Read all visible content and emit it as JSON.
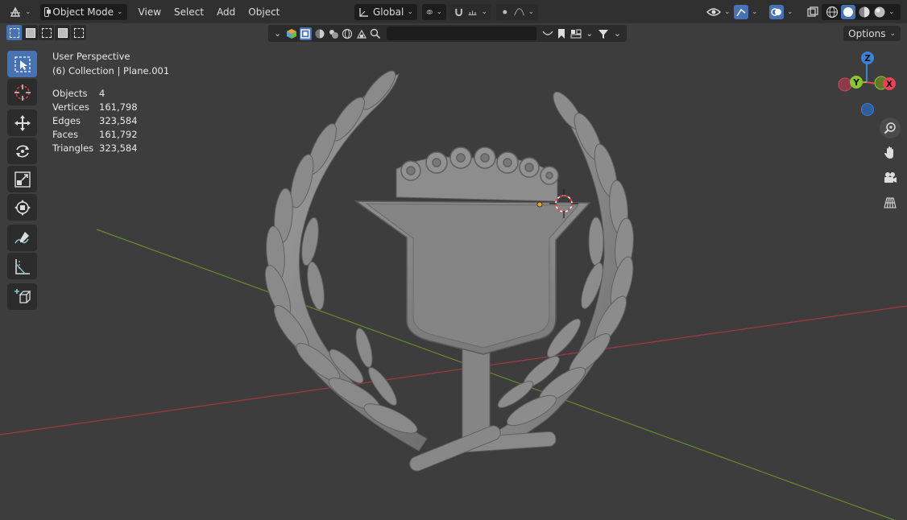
{
  "header": {
    "editor_type_icon": "3d-viewport-icon",
    "mode_label": "Object Mode",
    "menus": [
      "View",
      "Select",
      "Add",
      "Object"
    ],
    "transform_orientation": "Global"
  },
  "subbar": {
    "options_label": "Options",
    "search_placeholder": ""
  },
  "overlay": {
    "view_name": "User Perspective",
    "collection_info": "(6) Collection | Plane.001",
    "stats": [
      {
        "label": "Objects",
        "value": "4"
      },
      {
        "label": "Vertices",
        "value": "161,798"
      },
      {
        "label": "Edges",
        "value": "323,584"
      },
      {
        "label": "Faces",
        "value": "161,792"
      },
      {
        "label": "Triangles",
        "value": "323,584"
      }
    ]
  },
  "gizmo": {
    "axes": [
      "Z",
      "Y",
      "X"
    ],
    "colors": {
      "x": "#e8425a",
      "y": "#8cc62f",
      "z": "#3b82d8"
    }
  },
  "toolbar": {
    "tools": [
      "select-box",
      "cursor",
      "move",
      "rotate",
      "scale",
      "transform",
      "annotate",
      "measure",
      "add-cube"
    ]
  },
  "viewport": {
    "background": "#3d3d3d",
    "x_axis_color": "#a5383e",
    "y_axis_color": "#6b8a2b",
    "model_color": "#8a8a8a"
  }
}
